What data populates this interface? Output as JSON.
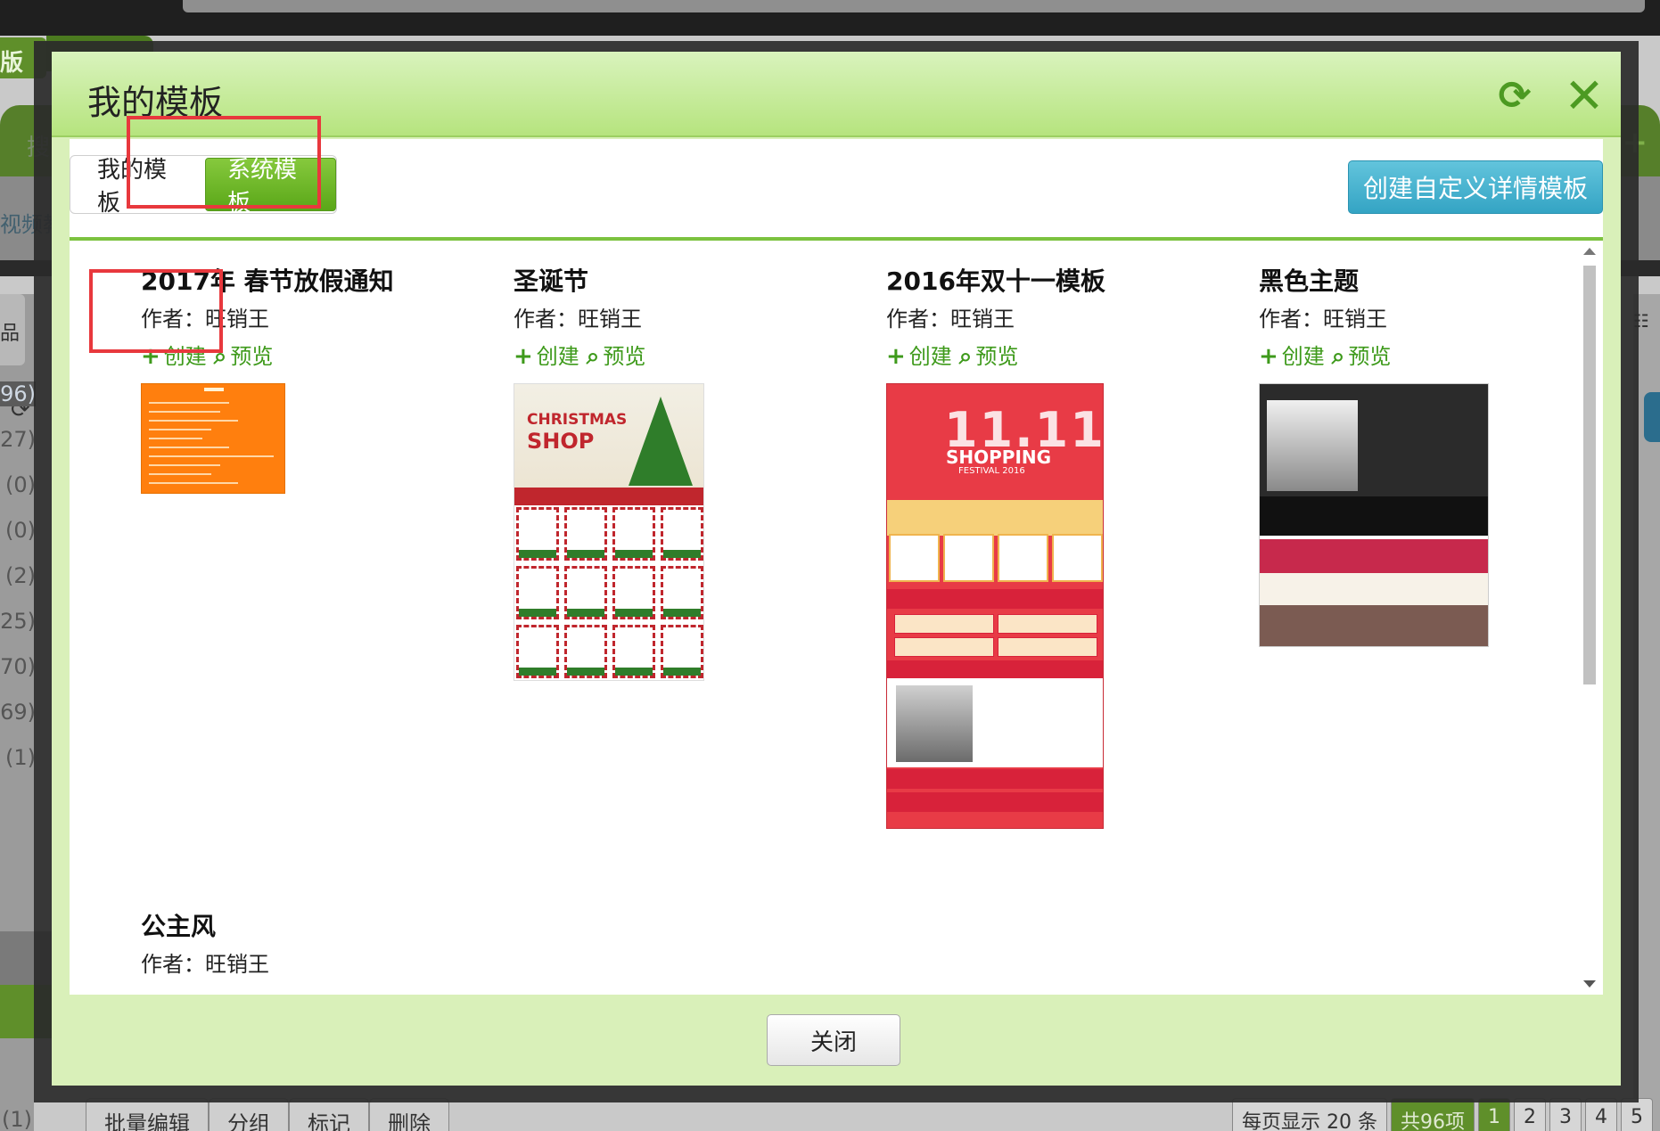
{
  "background": {
    "brand_text": "版",
    "search_text": "搜",
    "sub_text": "视频教程",
    "left_tab_text": "品",
    "counts": [
      "96)",
      "27)",
      "(0)",
      "(0)",
      "(2)",
      "25)",
      "70)",
      "69)",
      "(1)"
    ],
    "bottom_count": "(1)",
    "toolbar": [
      "批量编辑",
      "分组",
      "标记",
      "删除"
    ],
    "pager": {
      "per_page": "每页显示 20 条",
      "total": "共96项",
      "pages": [
        "1",
        "2",
        "3",
        "4",
        "5"
      ]
    }
  },
  "modal": {
    "title": "我的模板",
    "tabs": [
      {
        "label": "我的模板",
        "active": false
      },
      {
        "label": "系统模板",
        "active": true
      }
    ],
    "create_button": "创建自定义详情模板",
    "close_button": "关闭",
    "templates": [
      {
        "name": "2017年 春节放假通知",
        "author": "作者：旺销王",
        "create": "创建",
        "preview": "预览",
        "thumb": "orange"
      },
      {
        "name": "圣诞节",
        "author": "作者：旺销王",
        "create": "创建",
        "preview": "预览",
        "thumb": "xmas"
      },
      {
        "name": "2016年双十一模板",
        "author": "作者：旺销王",
        "create": "创建",
        "preview": "预览",
        "thumb": "1111"
      },
      {
        "name": "黑色主题",
        "author": "作者：旺销王",
        "create": "创建",
        "preview": "预览",
        "thumb": "black"
      },
      {
        "name": "公主风",
        "author": "作者：旺销王",
        "create": "创建",
        "preview": "预览",
        "thumb": "none"
      }
    ],
    "thumb_text": {
      "xmas_line1": "CHRISTMAS",
      "xmas_line2": "SHOP",
      "d1111_big": "11.11",
      "d1111_shop": "SHOPPING",
      "d1111_fest": "FESTIVAL 2016"
    }
  },
  "colors": {
    "accent_green": "#5aa718",
    "link_green": "#3e9a1b",
    "create_blue": "#34a4c4",
    "annotation_red": "#e8383d"
  }
}
